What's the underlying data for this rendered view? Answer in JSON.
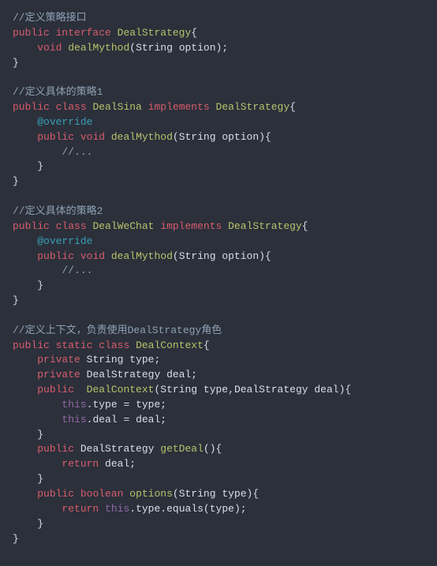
{
  "code": {
    "c1": "//定义策略接口",
    "l1_kw1": "public",
    "l1_kw2": "interface",
    "l1_type": "DealStrategy",
    "l1_brace_o": "{",
    "l2_kw": "void",
    "l2_meth": "dealMythod",
    "l2_p_o": "(",
    "l2_ptype": "String",
    "l2_pname": "option",
    "l2_p_c": ")",
    "l2_semi": ";",
    "l3_brace_c": "}",
    "c2": "//定义具体的策略1",
    "l4_kw1": "public",
    "l4_kw2": "class",
    "l4_type": "DealSina",
    "l4_kw3": "implements",
    "l4_type2": "DealStrategy",
    "l4_brace_o": "{",
    "l5_annot": "@override",
    "l6_kw1": "public",
    "l6_kw2": "void",
    "l6_meth": "dealMythod",
    "l6_p_o": "(",
    "l6_ptype": "String",
    "l6_pname": "option",
    "l6_p_c": ")",
    "l6_brace_o": "{",
    "l7_comment": "//...",
    "l8_brace_c": "}",
    "l9_brace_c": "}",
    "c3": "//定义具体的策略2",
    "l10_kw1": "public",
    "l10_kw2": "class",
    "l10_type": "DealWeChat",
    "l10_kw3": "implements",
    "l10_type2": "DealStrategy",
    "l10_brace_o": "{",
    "l11_annot": "@override",
    "l12_kw1": "public",
    "l12_kw2": "void",
    "l12_meth": "dealMythod",
    "l12_p_o": "(",
    "l12_ptype": "String",
    "l12_pname": "option",
    "l12_p_c": ")",
    "l12_brace_o": "{",
    "l13_comment": "//...",
    "l14_brace_c": "}",
    "l15_brace_c": "}",
    "c4": "//定义上下文，负责使用DealStrategy角色",
    "l16_kw1": "public",
    "l16_kw2": "static",
    "l16_kw3": "class",
    "l16_type": "DealContext",
    "l16_brace_o": "{",
    "l17_kw": "private",
    "l17_type": "String",
    "l17_name": "type",
    "l17_semi": ";",
    "l18_kw": "private",
    "l18_type": "DealStrategy",
    "l18_name": "deal",
    "l18_semi": ";",
    "l19_kw": "public",
    "l19_type": "DealContext",
    "l19_p_o": "(",
    "l19_ptype1": "String",
    "l19_pname1": "type",
    "l19_comma": ",",
    "l19_ptype2": "DealStrategy",
    "l19_pname2": "deal",
    "l19_p_c": ")",
    "l19_brace_o": "{",
    "l20_this": "this",
    "l20_dot": ".",
    "l20_field": "type",
    "l20_eq": " = ",
    "l20_rhs": "type",
    "l20_semi": ";",
    "l21_this": "this",
    "l21_dot": ".",
    "l21_field": "deal",
    "l21_eq": " = ",
    "l21_rhs": "deal",
    "l21_semi": ";",
    "l22_brace_c": "}",
    "l23_kw": "public",
    "l23_type": "DealStrategy",
    "l23_meth": "getDeal",
    "l23_p_o": "(",
    "l23_p_c": ")",
    "l23_brace_o": "{",
    "l24_kw": "return",
    "l24_name": "deal",
    "l24_semi": ";",
    "l25_brace_c": "}",
    "l26_kw1": "public",
    "l26_kw2": "boolean",
    "l26_meth": "options",
    "l26_p_o": "(",
    "l26_ptype": "String",
    "l26_pname": "type",
    "l26_p_c": ")",
    "l26_brace_o": "{",
    "l27_kw": "return",
    "l27_this": "this",
    "l27_dot": ".",
    "l27_field": "type",
    "l27_dot2": ".",
    "l27_meth": "equals",
    "l27_p_o": "(",
    "l27_arg": "type",
    "l27_p_c": ")",
    "l27_semi": ";",
    "l28_brace_c": "}",
    "l29_brace_c": "}"
  }
}
